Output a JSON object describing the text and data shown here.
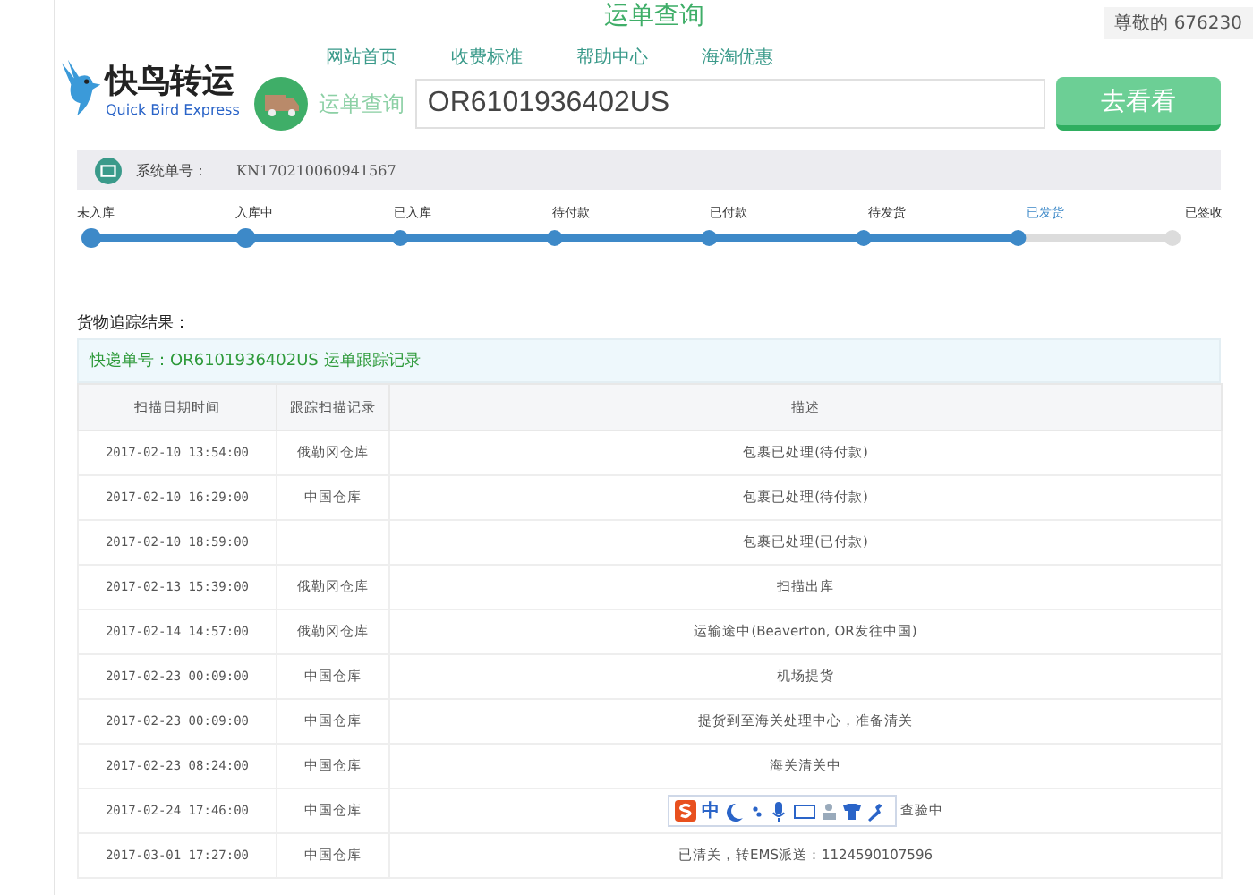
{
  "page_title": "运单查询",
  "greeting": "尊敬的 676230",
  "logo": {
    "name": "快鸟转运",
    "subtitle": "Quick Bird Express"
  },
  "nav": [
    "网站首页",
    "收费标准",
    "帮助中心",
    "海淘优惠"
  ],
  "search": {
    "label": "运单查询",
    "value": "OR6101936402US",
    "button": "去看看"
  },
  "system_number": {
    "label": "系统单号：",
    "value": "KN170210060941567"
  },
  "steps": [
    {
      "label": "未入库",
      "done": true,
      "selected": false
    },
    {
      "label": "入库中",
      "done": true,
      "selected": false
    },
    {
      "label": "已入库",
      "done": true,
      "selected": false
    },
    {
      "label": "待付款",
      "done": true,
      "selected": false
    },
    {
      "label": "已付款",
      "done": true,
      "selected": false
    },
    {
      "label": "待发货",
      "done": true,
      "selected": false
    },
    {
      "label": "已发货",
      "done": true,
      "selected": true
    },
    {
      "label": "已签收",
      "done": false,
      "selected": false
    }
  ],
  "result_title": "货物追踪结果：",
  "tracking_header": "快递单号：OR6101936402US 运单跟踪记录",
  "table": {
    "columns": [
      "扫描日期时间",
      "跟踪扫描记录",
      "描述"
    ],
    "rows": [
      {
        "cells": [
          "2017-02-10 13:54:00",
          "俄勒冈仓库",
          "包裹已处理(待付款)"
        ],
        "input_toolbar": false
      },
      {
        "cells": [
          "2017-02-10 16:29:00",
          "中国仓库",
          "包裹已处理(待付款)"
        ],
        "input_toolbar": false
      },
      {
        "cells": [
          "2017-02-10 18:59:00",
          "",
          "包裹已处理(已付款)"
        ],
        "input_toolbar": false
      },
      {
        "cells": [
          "2017-02-13 15:39:00",
          "俄勒冈仓库",
          "扫描出库"
        ],
        "input_toolbar": false
      },
      {
        "cells": [
          "2017-02-14 14:57:00",
          "俄勒冈仓库",
          "运输途中(Beaverton, OR发往中国)"
        ],
        "input_toolbar": false
      },
      {
        "cells": [
          "2017-02-23 00:09:00",
          "中国仓库",
          "机场提货"
        ],
        "input_toolbar": false
      },
      {
        "cells": [
          "2017-02-23 00:09:00",
          "中国仓库",
          "提货到至海关处理中心，准备清关"
        ],
        "input_toolbar": false
      },
      {
        "cells": [
          "2017-02-23 08:24:00",
          "中国仓库",
          "海关清关中"
        ],
        "input_toolbar": false
      },
      {
        "cells": [
          "2017-02-24 17:46:00",
          "中国仓库",
          "查验中"
        ],
        "input_toolbar": true
      },
      {
        "cells": [
          "2017-03-01 17:27:00",
          "中国仓库",
          "已清关，转EMS派送：1124590107596"
        ],
        "input_toolbar": false
      }
    ]
  },
  "ime_toolbar": {
    "mode": "中"
  }
}
